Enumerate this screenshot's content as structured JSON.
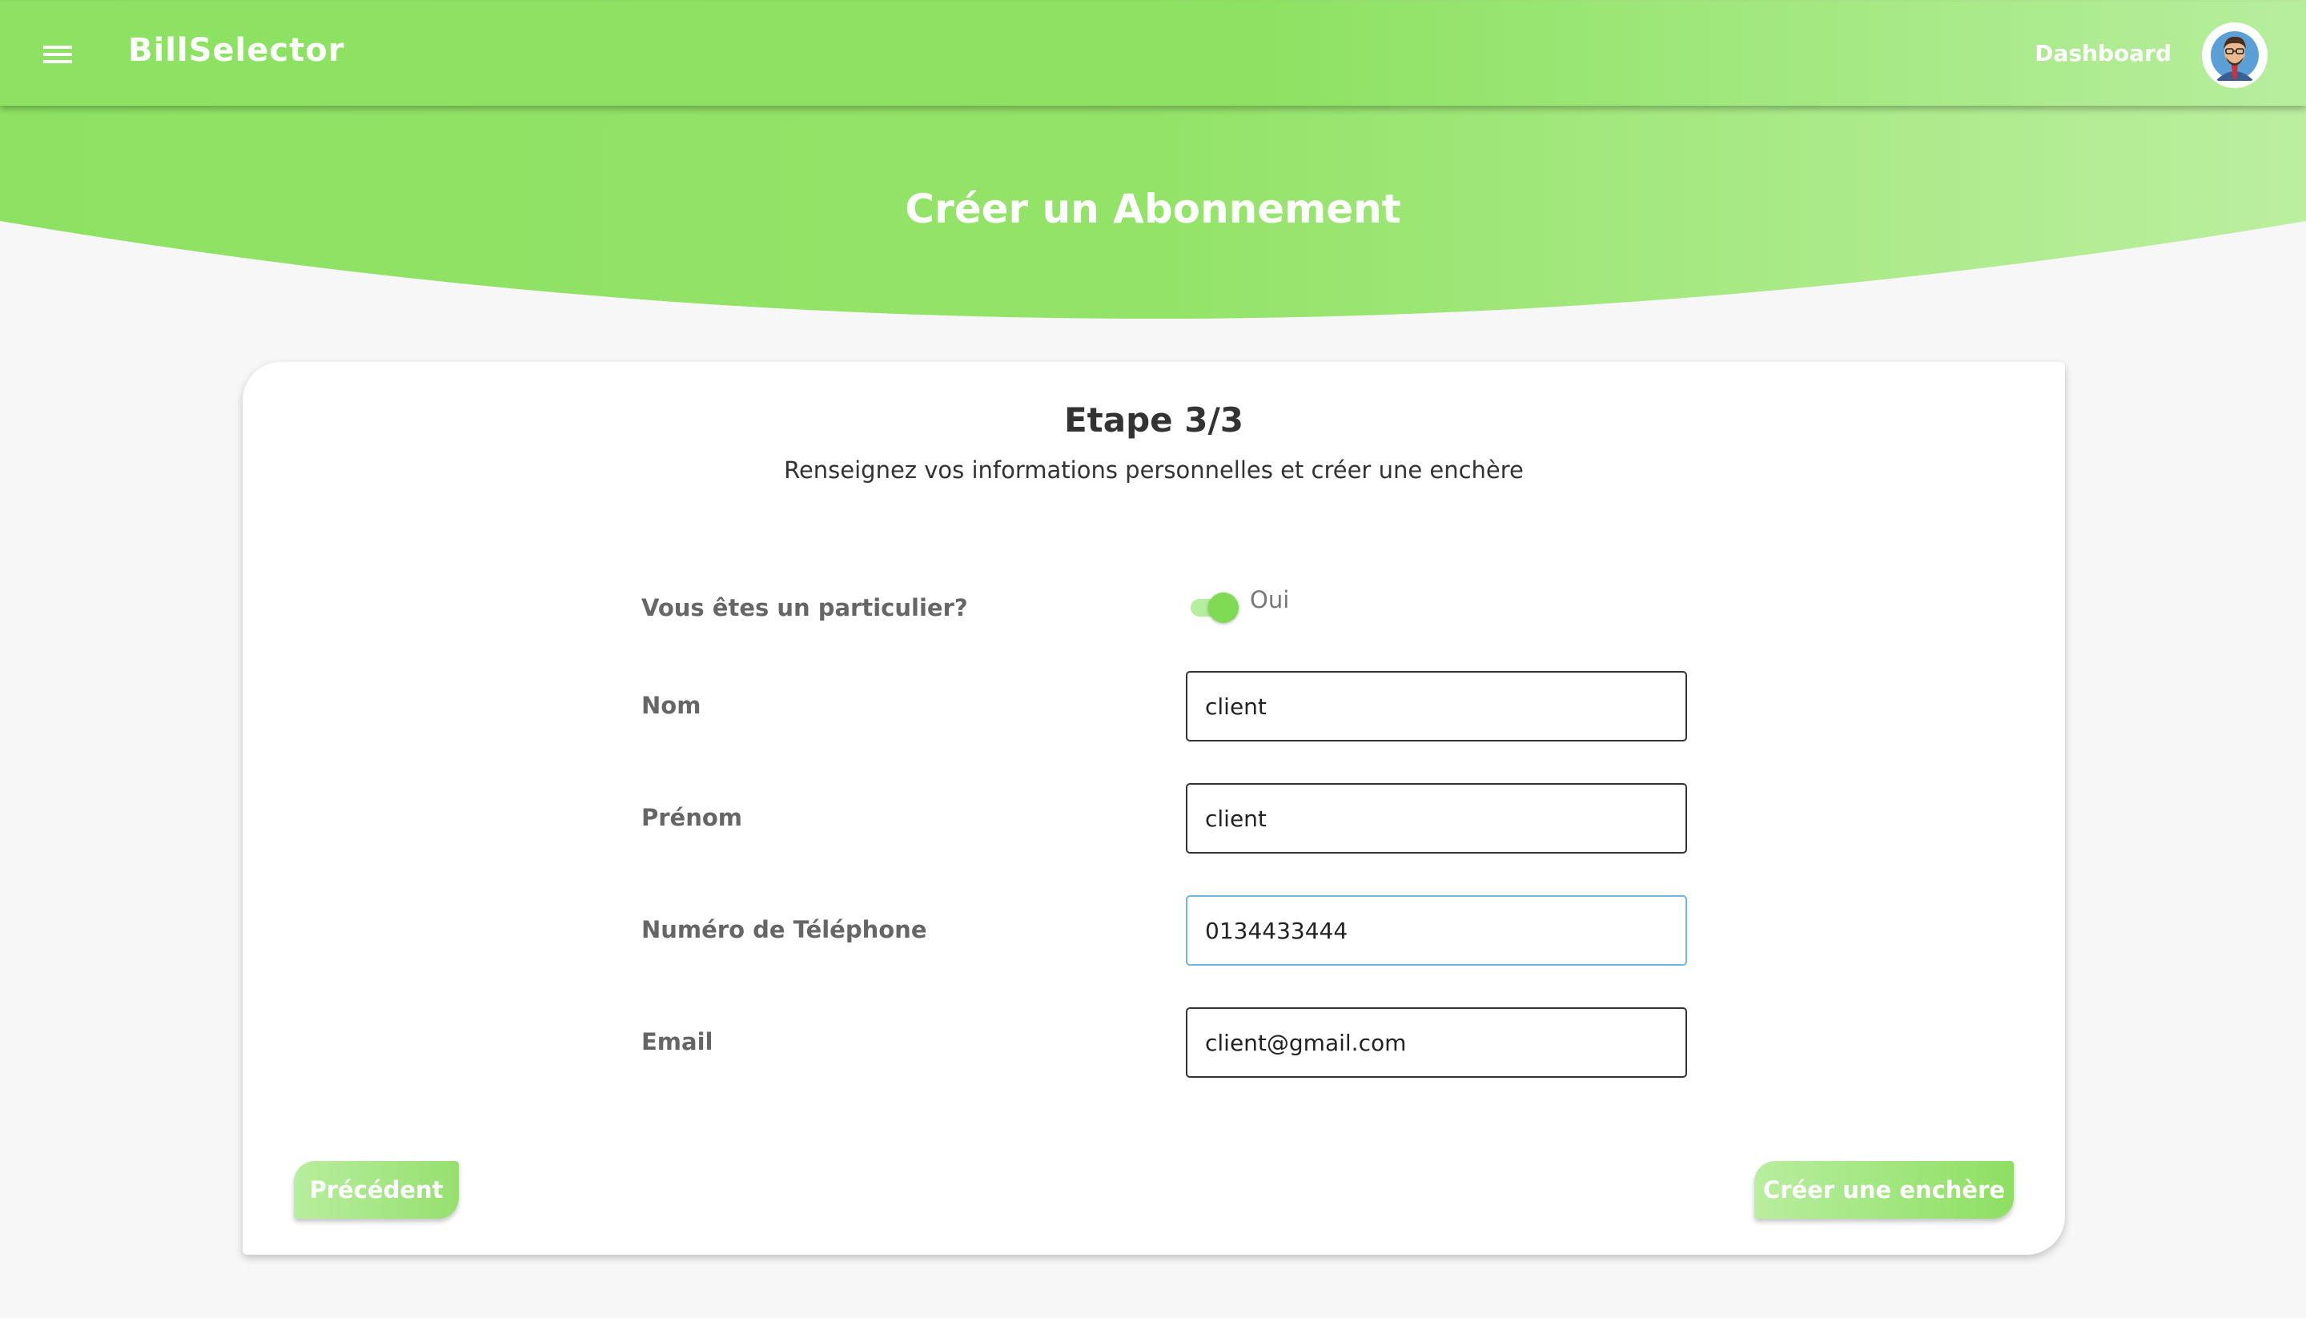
{
  "header": {
    "brand": "BillSelector",
    "dashboard_link": "Dashboard"
  },
  "page": {
    "title": "Créer un Abonnement"
  },
  "form": {
    "step_title": "Etape 3/3",
    "step_subtitle": "Renseignez vos informations personnelles et créer une enchère",
    "individual": {
      "label": "Vous êtes un particulier?",
      "toggle_text": "Oui",
      "checked": true
    },
    "fields": {
      "nom": {
        "label": "Nom",
        "value": "client"
      },
      "prenom": {
        "label": "Prénom",
        "value": "client"
      },
      "telephone": {
        "label": "Numéro de Téléphone",
        "value": "0134433444"
      },
      "email": {
        "label": "Email",
        "value": "client@gmail.com"
      }
    },
    "buttons": {
      "previous": "Précédent",
      "create": "Créer une enchère"
    }
  },
  "colors": {
    "primary_green": "#8ee263",
    "light_green": "#b7ee9d",
    "focus_border": "#6ab6e6"
  }
}
